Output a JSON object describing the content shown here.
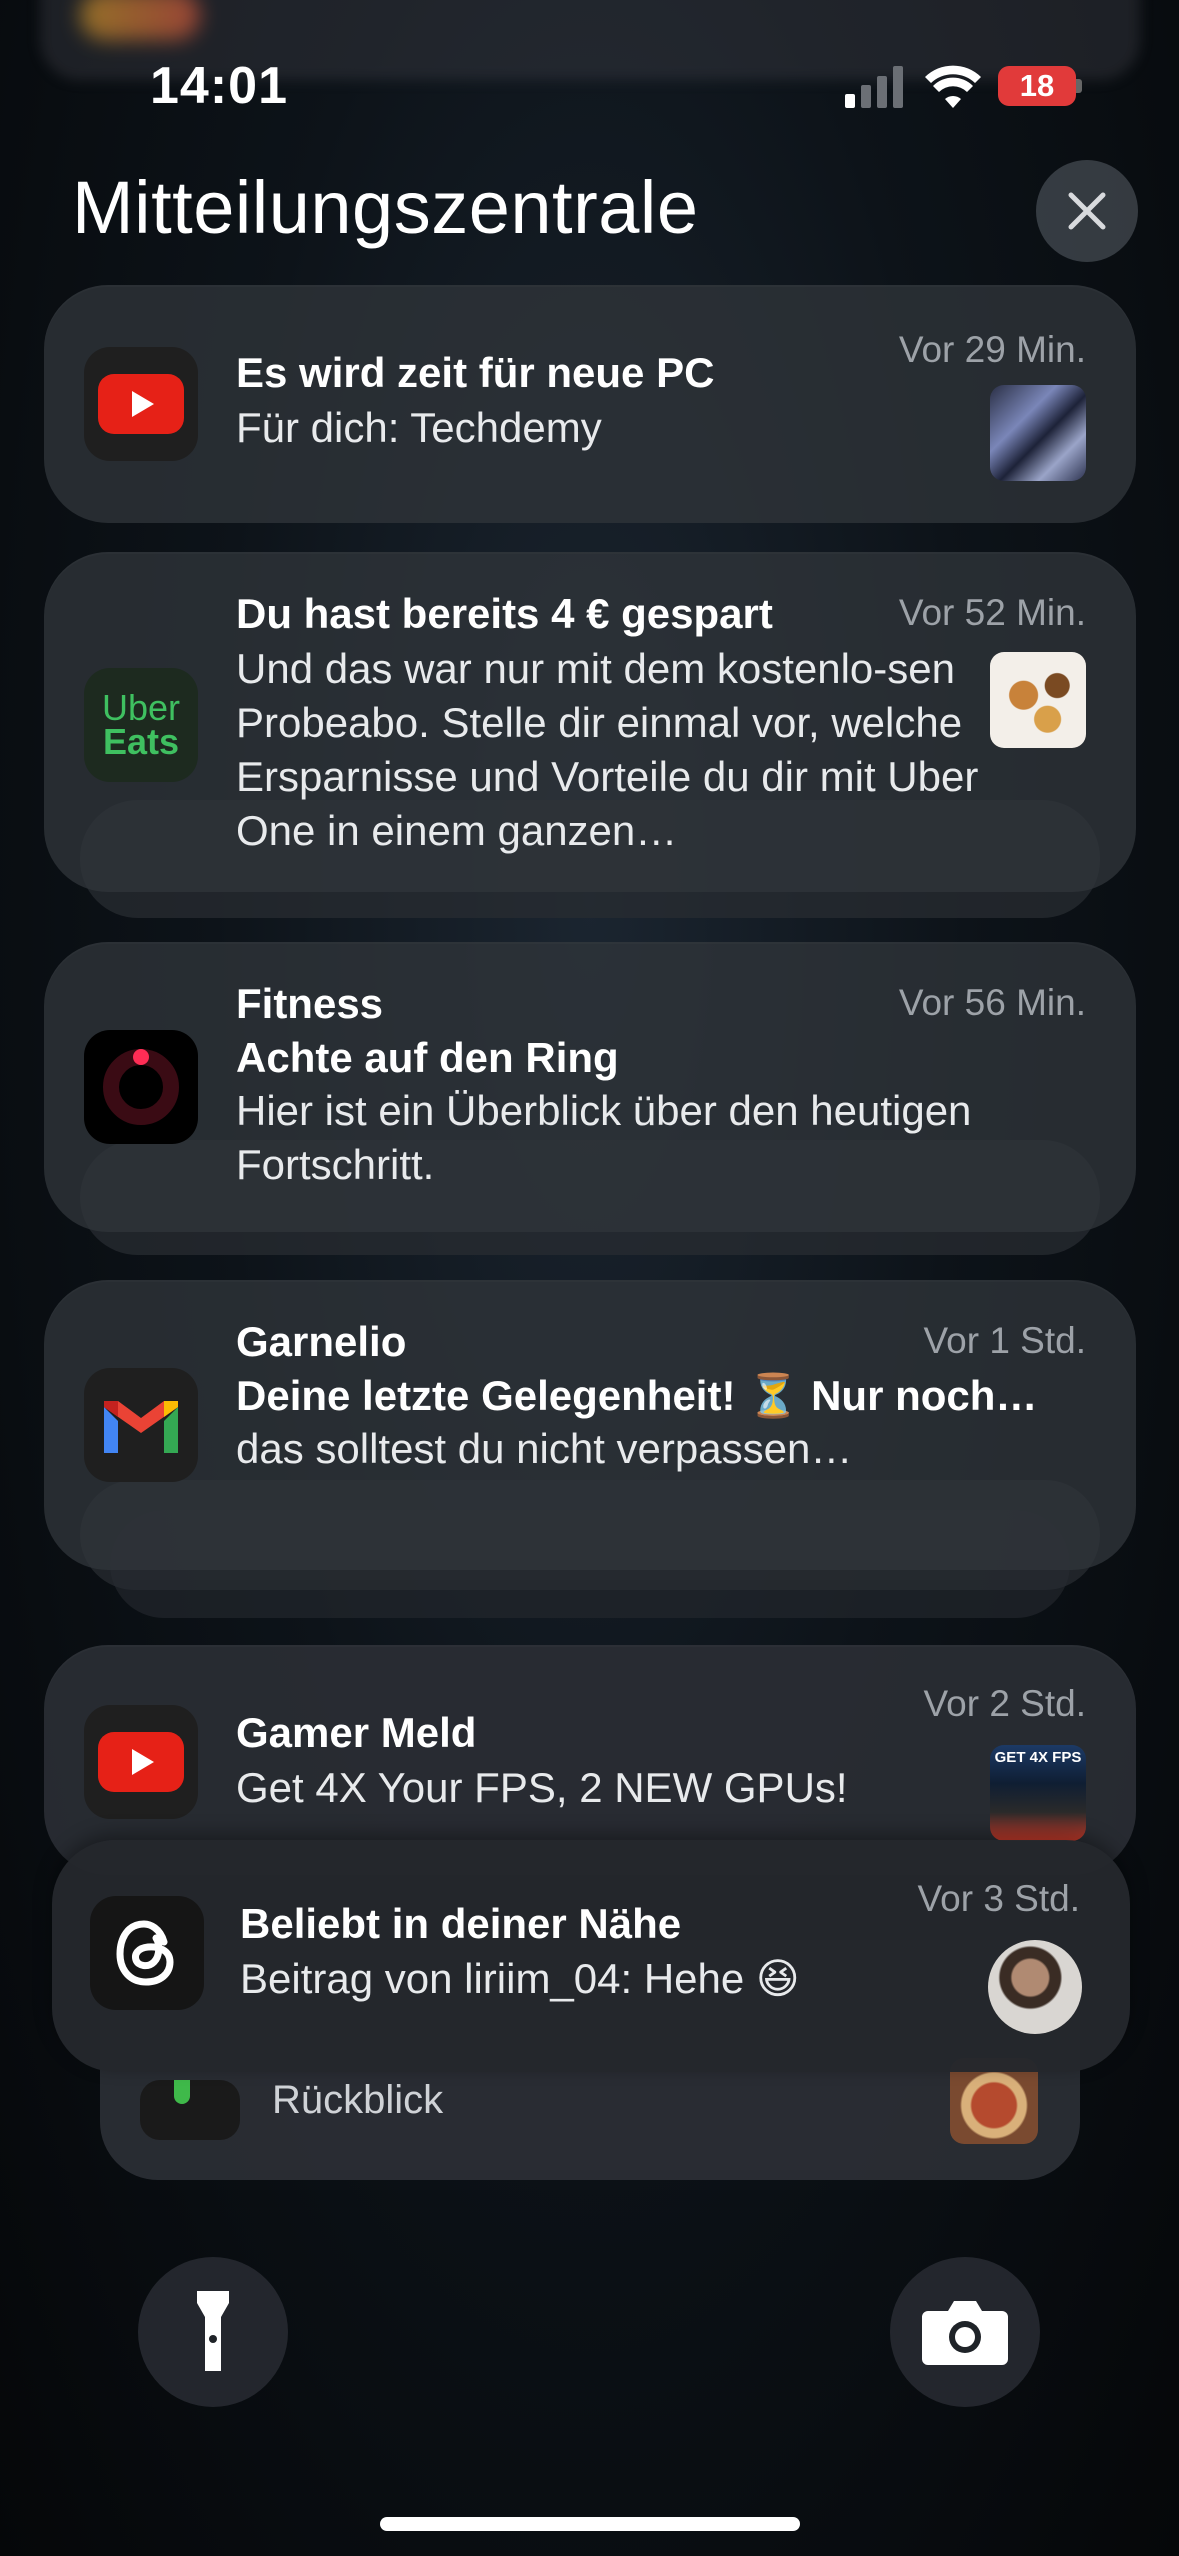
{
  "status_bar": {
    "time": "14:01",
    "battery_level": "18",
    "battery_color": "#e13a3a",
    "signal_icon": "cellular-signal-icon",
    "wifi_icon": "wifi-icon"
  },
  "header": {
    "title": "Mitteilungszentrale",
    "close_icon": "close-icon"
  },
  "notifications": [
    {
      "app": "YouTube",
      "title": "Es wird zeit für neue PC",
      "body": "Für dich: Techdemy",
      "time": "Vor 29 Min."
    },
    {
      "app": "Uber Eats",
      "icon_text_line1": "Uber",
      "icon_text_line2": "Eats",
      "title": "Du hast bereits 4 €  gespart",
      "body": "Und das war nur mit dem kostenlo-sen Probeabo. Stelle dir einmal vor, welche Ersparnisse und Vorteile du dir mit Uber One in einem ganzen…",
      "time": "Vor 52 Min."
    },
    {
      "app": "Fitness",
      "title": "Fitness",
      "subtitle": "Achte auf den Ring",
      "body": "Hier ist ein Überblick über den heutigen Fortschritt.",
      "time": "Vor 56 Min."
    },
    {
      "app": "Gmail",
      "title": "Garnelio",
      "subtitle": "Deine letzte Gelegenheit! ⏳ Nur noch…",
      "body": "das solltest du nicht verpassen…",
      "time": "Vor 1 Std."
    },
    {
      "app": "YouTube",
      "title": "Gamer Meld",
      "body": "Get 4X Your FPS, 2 NEW GPUs!",
      "thumb_text": "GET 4X FPS",
      "time": "Vor 2 Std."
    },
    {
      "app": "Threads",
      "title": "Beliebt in deiner Nähe",
      "body": "Beitrag von liriim_04: Hehe 😆",
      "time": "Vor 3 Std."
    },
    {
      "app": "Fitness",
      "body": "Rückblick"
    }
  ],
  "bottom": {
    "flashlight_icon": "flashlight-icon",
    "camera_icon": "camera-icon"
  }
}
